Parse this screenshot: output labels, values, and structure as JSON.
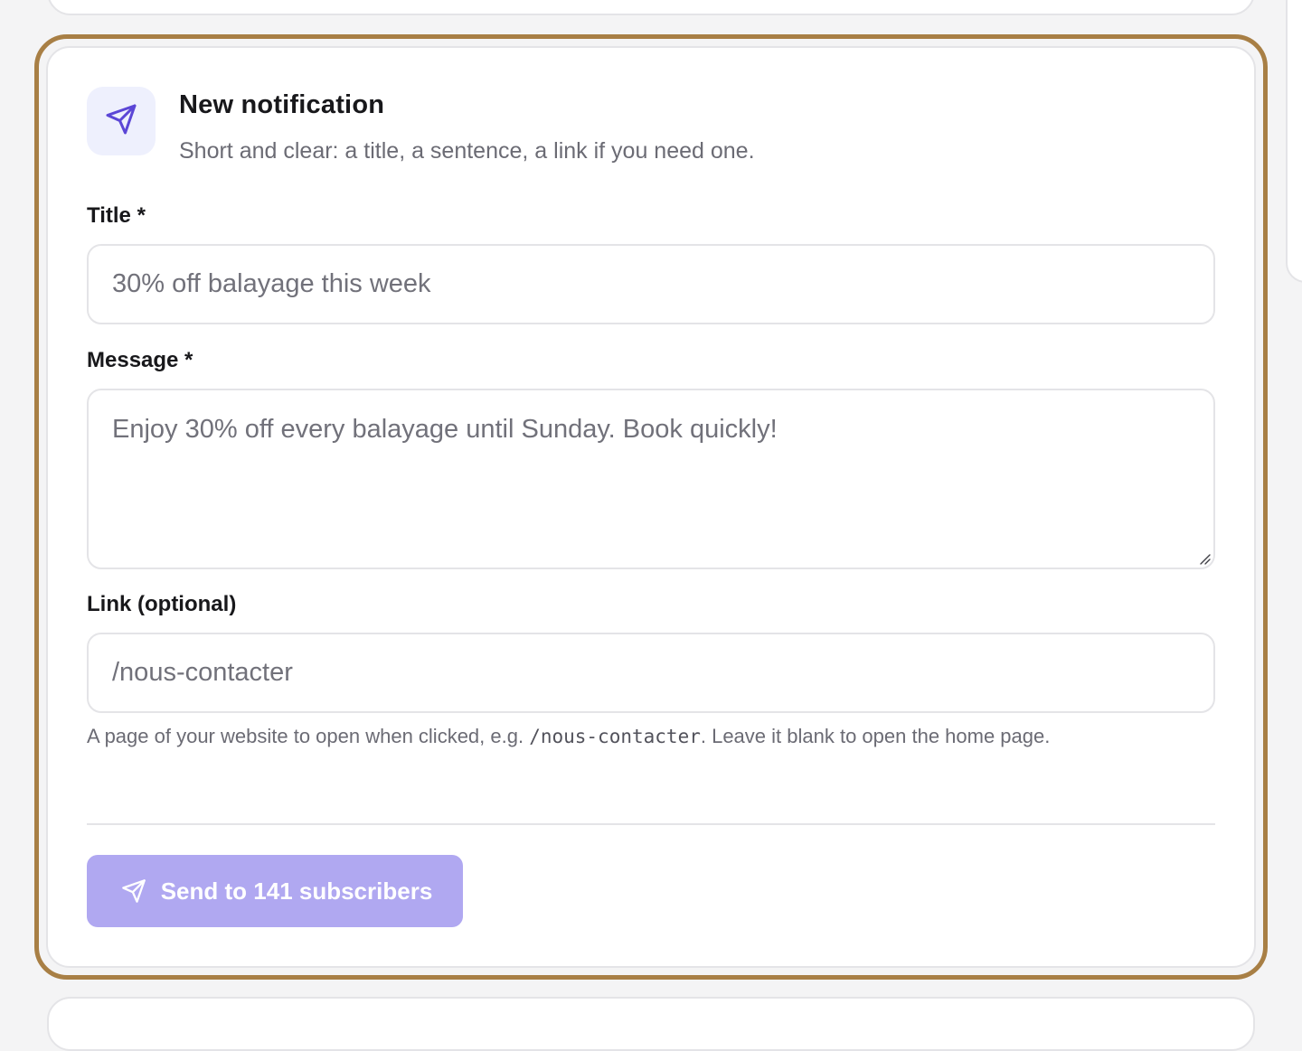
{
  "notification_form": {
    "header": {
      "icon": "send-icon",
      "title": "New notification",
      "subtitle": "Short and clear: a title, a sentence, a link if you need one."
    },
    "title_field": {
      "label": "Title *",
      "placeholder": "30% off balayage this week",
      "value": ""
    },
    "message_field": {
      "label": "Message *",
      "placeholder": "Enjoy 30% off every balayage until Sunday. Book quickly!",
      "value": ""
    },
    "link_field": {
      "label": "Link (optional)",
      "placeholder": "/nous-contacter",
      "value": "",
      "help_before": "A page of your website to open when clicked, e.g. ",
      "help_code": "/nous-contacter",
      "help_after": ". Leave it blank to open the home page."
    },
    "send_button": {
      "icon": "send-icon",
      "label": "Send to 141 subscribers",
      "disabled": true
    }
  },
  "colors": {
    "highlight_ring": "#a87f45",
    "accent": "#5b46d6",
    "icon_bg": "#eef0fd",
    "button_disabled": "#b0a8f1"
  }
}
